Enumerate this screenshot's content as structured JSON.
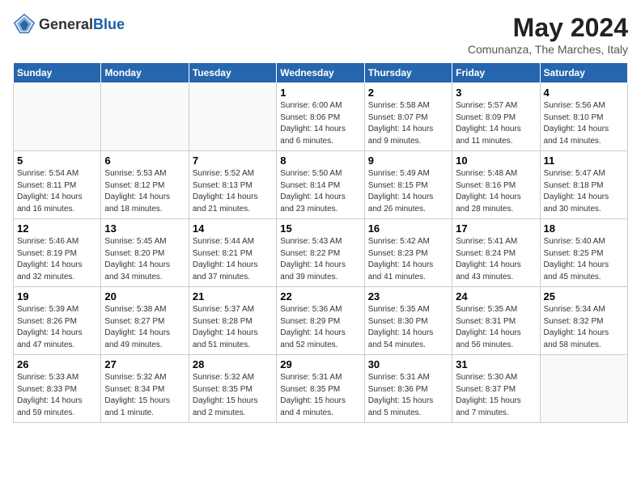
{
  "logo": {
    "general": "General",
    "blue": "Blue"
  },
  "title": "May 2024",
  "location": "Comunanza, The Marches, Italy",
  "days_of_week": [
    "Sunday",
    "Monday",
    "Tuesday",
    "Wednesday",
    "Thursday",
    "Friday",
    "Saturday"
  ],
  "weeks": [
    [
      {
        "day": "",
        "empty": true
      },
      {
        "day": "",
        "empty": true
      },
      {
        "day": "",
        "empty": true
      },
      {
        "day": "1",
        "sunrise": "Sunrise: 6:00 AM",
        "sunset": "Sunset: 8:06 PM",
        "daylight": "Daylight: 14 hours and 6 minutes."
      },
      {
        "day": "2",
        "sunrise": "Sunrise: 5:58 AM",
        "sunset": "Sunset: 8:07 PM",
        "daylight": "Daylight: 14 hours and 9 minutes."
      },
      {
        "day": "3",
        "sunrise": "Sunrise: 5:57 AM",
        "sunset": "Sunset: 8:09 PM",
        "daylight": "Daylight: 14 hours and 11 minutes."
      },
      {
        "day": "4",
        "sunrise": "Sunrise: 5:56 AM",
        "sunset": "Sunset: 8:10 PM",
        "daylight": "Daylight: 14 hours and 14 minutes."
      }
    ],
    [
      {
        "day": "5",
        "sunrise": "Sunrise: 5:54 AM",
        "sunset": "Sunset: 8:11 PM",
        "daylight": "Daylight: 14 hours and 16 minutes."
      },
      {
        "day": "6",
        "sunrise": "Sunrise: 5:53 AM",
        "sunset": "Sunset: 8:12 PM",
        "daylight": "Daylight: 14 hours and 18 minutes."
      },
      {
        "day": "7",
        "sunrise": "Sunrise: 5:52 AM",
        "sunset": "Sunset: 8:13 PM",
        "daylight": "Daylight: 14 hours and 21 minutes."
      },
      {
        "day": "8",
        "sunrise": "Sunrise: 5:50 AM",
        "sunset": "Sunset: 8:14 PM",
        "daylight": "Daylight: 14 hours and 23 minutes."
      },
      {
        "day": "9",
        "sunrise": "Sunrise: 5:49 AM",
        "sunset": "Sunset: 8:15 PM",
        "daylight": "Daylight: 14 hours and 26 minutes."
      },
      {
        "day": "10",
        "sunrise": "Sunrise: 5:48 AM",
        "sunset": "Sunset: 8:16 PM",
        "daylight": "Daylight: 14 hours and 28 minutes."
      },
      {
        "day": "11",
        "sunrise": "Sunrise: 5:47 AM",
        "sunset": "Sunset: 8:18 PM",
        "daylight": "Daylight: 14 hours and 30 minutes."
      }
    ],
    [
      {
        "day": "12",
        "sunrise": "Sunrise: 5:46 AM",
        "sunset": "Sunset: 8:19 PM",
        "daylight": "Daylight: 14 hours and 32 minutes."
      },
      {
        "day": "13",
        "sunrise": "Sunrise: 5:45 AM",
        "sunset": "Sunset: 8:20 PM",
        "daylight": "Daylight: 14 hours and 34 minutes."
      },
      {
        "day": "14",
        "sunrise": "Sunrise: 5:44 AM",
        "sunset": "Sunset: 8:21 PM",
        "daylight": "Daylight: 14 hours and 37 minutes."
      },
      {
        "day": "15",
        "sunrise": "Sunrise: 5:43 AM",
        "sunset": "Sunset: 8:22 PM",
        "daylight": "Daylight: 14 hours and 39 minutes."
      },
      {
        "day": "16",
        "sunrise": "Sunrise: 5:42 AM",
        "sunset": "Sunset: 8:23 PM",
        "daylight": "Daylight: 14 hours and 41 minutes."
      },
      {
        "day": "17",
        "sunrise": "Sunrise: 5:41 AM",
        "sunset": "Sunset: 8:24 PM",
        "daylight": "Daylight: 14 hours and 43 minutes."
      },
      {
        "day": "18",
        "sunrise": "Sunrise: 5:40 AM",
        "sunset": "Sunset: 8:25 PM",
        "daylight": "Daylight: 14 hours and 45 minutes."
      }
    ],
    [
      {
        "day": "19",
        "sunrise": "Sunrise: 5:39 AM",
        "sunset": "Sunset: 8:26 PM",
        "daylight": "Daylight: 14 hours and 47 minutes."
      },
      {
        "day": "20",
        "sunrise": "Sunrise: 5:38 AM",
        "sunset": "Sunset: 8:27 PM",
        "daylight": "Daylight: 14 hours and 49 minutes."
      },
      {
        "day": "21",
        "sunrise": "Sunrise: 5:37 AM",
        "sunset": "Sunset: 8:28 PM",
        "daylight": "Daylight: 14 hours and 51 minutes."
      },
      {
        "day": "22",
        "sunrise": "Sunrise: 5:36 AM",
        "sunset": "Sunset: 8:29 PM",
        "daylight": "Daylight: 14 hours and 52 minutes."
      },
      {
        "day": "23",
        "sunrise": "Sunrise: 5:35 AM",
        "sunset": "Sunset: 8:30 PM",
        "daylight": "Daylight: 14 hours and 54 minutes."
      },
      {
        "day": "24",
        "sunrise": "Sunrise: 5:35 AM",
        "sunset": "Sunset: 8:31 PM",
        "daylight": "Daylight: 14 hours and 56 minutes."
      },
      {
        "day": "25",
        "sunrise": "Sunrise: 5:34 AM",
        "sunset": "Sunset: 8:32 PM",
        "daylight": "Daylight: 14 hours and 58 minutes."
      }
    ],
    [
      {
        "day": "26",
        "sunrise": "Sunrise: 5:33 AM",
        "sunset": "Sunset: 8:33 PM",
        "daylight": "Daylight: 14 hours and 59 minutes."
      },
      {
        "day": "27",
        "sunrise": "Sunrise: 5:32 AM",
        "sunset": "Sunset: 8:34 PM",
        "daylight": "Daylight: 15 hours and 1 minute."
      },
      {
        "day": "28",
        "sunrise": "Sunrise: 5:32 AM",
        "sunset": "Sunset: 8:35 PM",
        "daylight": "Daylight: 15 hours and 2 minutes."
      },
      {
        "day": "29",
        "sunrise": "Sunrise: 5:31 AM",
        "sunset": "Sunset: 8:35 PM",
        "daylight": "Daylight: 15 hours and 4 minutes."
      },
      {
        "day": "30",
        "sunrise": "Sunrise: 5:31 AM",
        "sunset": "Sunset: 8:36 PM",
        "daylight": "Daylight: 15 hours and 5 minutes."
      },
      {
        "day": "31",
        "sunrise": "Sunrise: 5:30 AM",
        "sunset": "Sunset: 8:37 PM",
        "daylight": "Daylight: 15 hours and 7 minutes."
      },
      {
        "day": "",
        "empty": true
      }
    ]
  ]
}
